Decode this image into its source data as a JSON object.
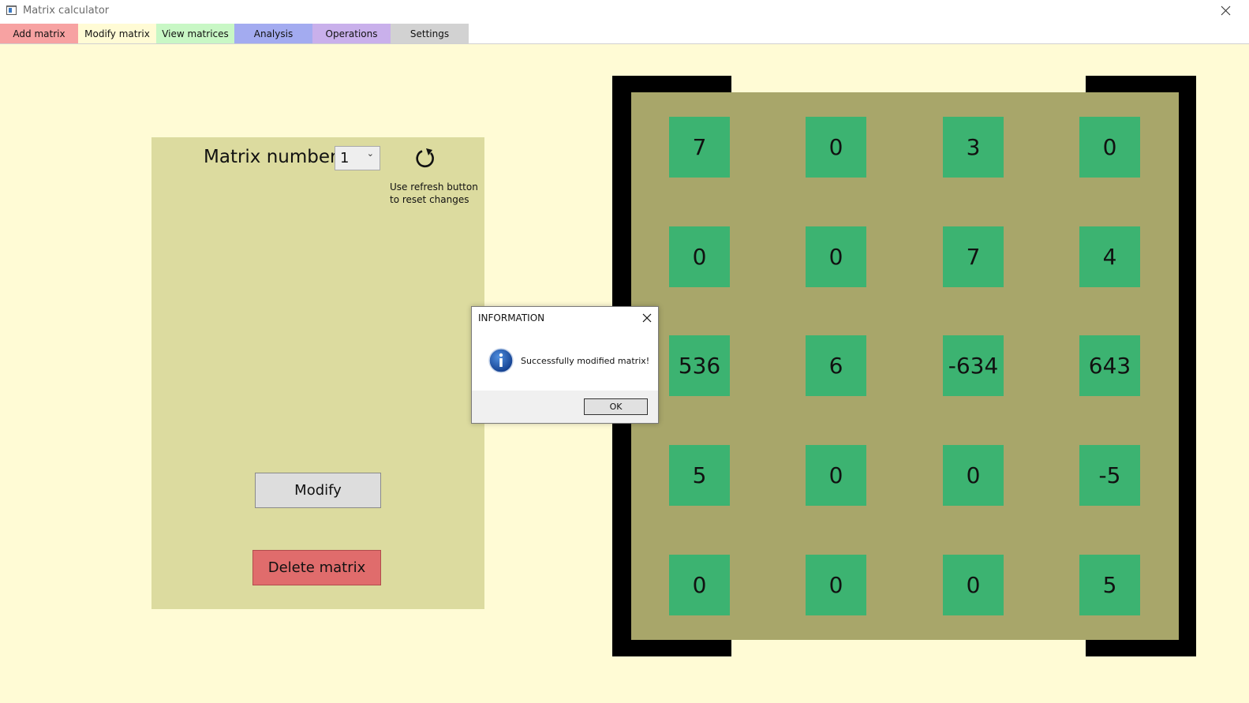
{
  "window": {
    "title": "Matrix calculator"
  },
  "tabs": [
    {
      "label": "Add matrix",
      "color": "#f7a2a2"
    },
    {
      "label": "Modify matrix",
      "color": "#fffbd5"
    },
    {
      "label": "View matrices",
      "color": "#c8f7c5"
    },
    {
      "label": "Analysis",
      "color": "#a3abf0"
    },
    {
      "label": "Operations",
      "color": "#c9b0eb"
    },
    {
      "label": "Settings",
      "color": "#d2d2d2"
    }
  ],
  "left_panel": {
    "matrix_number_label": "Matrix number:",
    "matrix_number_value": "1",
    "refresh_hint_line1": "Use refresh button",
    "refresh_hint_line2": "to reset changes",
    "modify_label": "Modify",
    "delete_label": "Delete matrix"
  },
  "matrix": {
    "rows": [
      [
        "7",
        "0",
        "3",
        "0"
      ],
      [
        "0",
        "0",
        "7",
        "4"
      ],
      [
        "536",
        "6",
        "-634",
        "643"
      ],
      [
        "5",
        "0",
        "0",
        "-5"
      ],
      [
        "0",
        "0",
        "0",
        "5"
      ]
    ]
  },
  "dialog": {
    "title": "INFORMATION",
    "message": "Successfully modified matrix!",
    "ok_label": "OK"
  },
  "colors": {
    "background": "#fffbd5",
    "panel": "#dcdb9f",
    "matrix_background": "#a8a66a",
    "cell": "#3cb371",
    "delete_button": "#e06c6c"
  }
}
